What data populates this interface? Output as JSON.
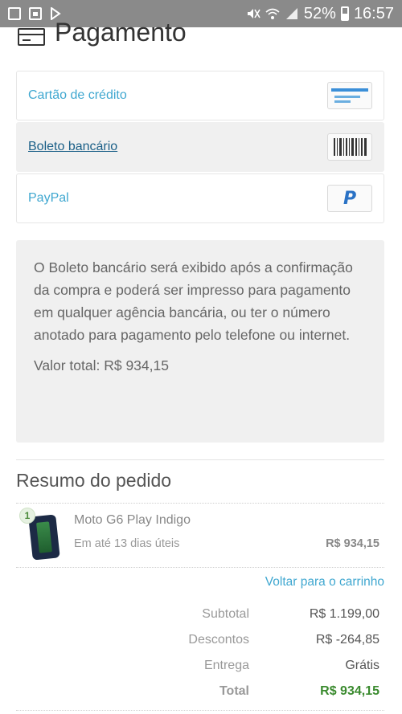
{
  "status_bar": {
    "battery": "52%",
    "time": "16:57"
  },
  "header": {
    "title": "Pagamento"
  },
  "payment_options": [
    {
      "label": "Cartão de crédito",
      "icon": "credit-card-icon",
      "selected": false
    },
    {
      "label": "Boleto bancário",
      "icon": "barcode-icon",
      "selected": true
    },
    {
      "label": "PayPal",
      "icon": "paypal-icon",
      "selected": false
    }
  ],
  "paypal_glyph": "P",
  "info_box": {
    "message": "O Boleto bancário será exibido após a confirmação da compra e poderá ser impresso para pagamento em qualquer agência bancária, ou ter o número anotado para pagamento pelo telefone ou internet.",
    "total": "Valor total: R$ 934,15"
  },
  "summary": {
    "title": "Resumo do pedido",
    "item": {
      "quantity": "1",
      "name": "Moto G6 Play Indigo",
      "shipping": "Em até 13 dias úteis",
      "price": "R$ 934,15"
    },
    "back_link": "Voltar para o carrinho",
    "totals": {
      "subtotal_label": "Subtotal",
      "subtotal_value": "R$ 1.199,00",
      "discount_label": "Descontos",
      "discount_value": "R$ -264,85",
      "delivery_label": "Entrega",
      "delivery_value": "Grátis",
      "total_label": "Total",
      "total_value": "R$ 934,15"
    }
  },
  "colors": {
    "link": "#3fa7d0",
    "selected_link": "#1a5f87",
    "total_green": "#3a8a2e",
    "status_bar": "#8a8a8a"
  }
}
